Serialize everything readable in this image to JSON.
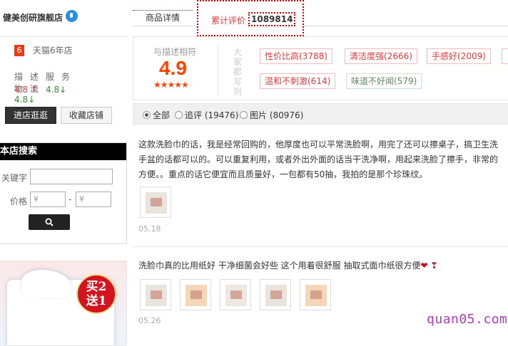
{
  "shop": {
    "name": "健美创研旗舰店",
    "tmall_badge": "6",
    "tmall_years": "天猫6年店",
    "ratings": [
      {
        "label": "描 述",
        "value": "4.8 ↑",
        "trend": "up",
        "color": "#e4393c"
      },
      {
        "label": "服 务",
        "value": "4.8↓",
        "trend": "down",
        "color": "#2f8a2f"
      },
      {
        "label": "物 流",
        "value": "4.8↓",
        "trend": "down",
        "color": "#2f8a2f"
      }
    ],
    "enter_button": "进店逛逛",
    "favorite_button": "收藏店铺"
  },
  "search": {
    "title": "本店搜索",
    "keyword_label": "关键字",
    "price_label": "价格",
    "price_min_placeholder": "¥",
    "price_max_placeholder": "¥",
    "price_separator": "-",
    "button_icon": "search-icon"
  },
  "promo": {
    "badge_line1": "买2",
    "badge_line2": "送1"
  },
  "tabs": {
    "detail": "商品详情",
    "reviews_label": "累计评价",
    "reviews_count": "1089814"
  },
  "summary": {
    "score_label": "与描述相符",
    "score": "4.9",
    "stars": "★★★★★",
    "tags_title": "大家都写到",
    "tags": [
      {
        "text": "性价比高(3788)",
        "sentiment": "positive"
      },
      {
        "text": "清洁度强(2666)",
        "sentiment": "positive"
      },
      {
        "text": "手感好(2009)",
        "sentiment": "positive"
      },
      {
        "text": "温和不刺激(614)",
        "sentiment": "positive"
      },
      {
        "text": "味道不好闻(579)",
        "sentiment": "negative"
      }
    ]
  },
  "filter": {
    "options": [
      {
        "label": "全部",
        "selected": true
      },
      {
        "label": "追评 (19476)",
        "selected": false
      },
      {
        "label": "图片 (80976)",
        "selected": false
      }
    ]
  },
  "reviews": [
    {
      "text": "这款洗脸巾的话，我是经常回购的，他厚度也可以平常洗脸啊，用完了还可以擦桌子，搞卫生洗手盆的话都可以的。可以重复利用，或者外出外面的话当干洗净啊，用起来洗脸了擦手，非常的方便。。重点的话它便宜而且质量好，一包都有50抽，我拍的是那个珍珠纹。",
      "images": 1,
      "date": "05.18"
    },
    {
      "text": "洗脸巾真的比用纸好 干净细菌会好些 这个用着很舒服 抽取式面巾纸很方便",
      "emoji": "❤",
      "images": 5,
      "date": "05.26"
    }
  ],
  "watermark": "quan05.com"
}
